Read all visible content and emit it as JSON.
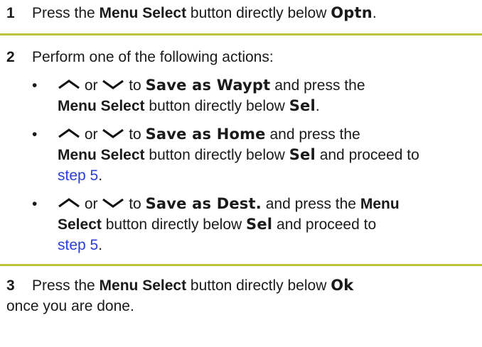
{
  "steps": [
    {
      "num": "1",
      "pre": "Press the ",
      "button": "Menu Select",
      "mid": " button directly below ",
      "lcd": "Optn",
      "post": "."
    },
    {
      "num": "2",
      "intro": "Perform one of the following actions:",
      "bullets": [
        {
          "or": "or",
          "to": "to",
          "lcd_target": "Save as Waypt",
          "and_press": "and press the",
          "button": "Menu Select",
          "below": "button directly below",
          "lcd_sel": "Sel",
          "end": "."
        },
        {
          "or": "or",
          "to": "to",
          "lcd_target": "Save as Home",
          "and_press": "and press the",
          "button": "Menu Select",
          "below": "button directly below",
          "lcd_sel": "Sel",
          "proceed": "and proceed to",
          "link": "step 5",
          "end": "."
        },
        {
          "or": "or",
          "to": "to",
          "lcd_target": "Save as Dest.",
          "and_press": "and press the",
          "button_a": "Menu",
          "button_b": "Select",
          "below": "button directly below",
          "lcd_sel": "Sel",
          "proceed": "and proceed to",
          "link": "step 5",
          "end": "."
        }
      ]
    },
    {
      "num": "3",
      "pre": "Press the ",
      "button": "Menu Select",
      "mid": " button directly below ",
      "lcd": "Ok",
      "line2": "once you are done."
    }
  ],
  "icons": {
    "up": "up-arrow-icon",
    "down": "down-arrow-icon"
  },
  "colors": {
    "divider": "#bcc43a",
    "link": "#2a3fd8"
  }
}
